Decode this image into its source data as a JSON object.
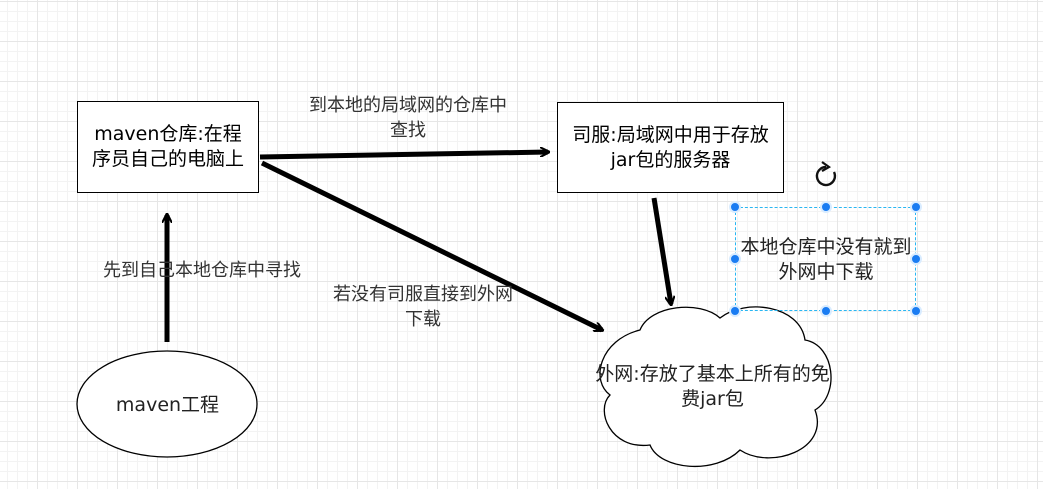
{
  "nodes": {
    "maven_repo": "maven仓库:在程序员自己的电脑上",
    "private_server": "司服:局域网中用于存放jar包的服务器",
    "internet": "外网:存放了基本上所有的免费jar包",
    "maven_project": "maven工程",
    "selected_note": "本地仓库中没有就到外网中下载"
  },
  "edges": {
    "project_to_repo": "先到自己本地仓库中寻找",
    "repo_to_server": "到本地的局域网的仓库中查找",
    "repo_to_internet": "若没有司服直接到外网下载",
    "server_to_internet": ""
  },
  "colors": {
    "grid": "#e6e6e6",
    "selection": "#29b6f2",
    "handle": "#1a7cf2"
  },
  "icons": {
    "rotate": "rotate-icon"
  }
}
